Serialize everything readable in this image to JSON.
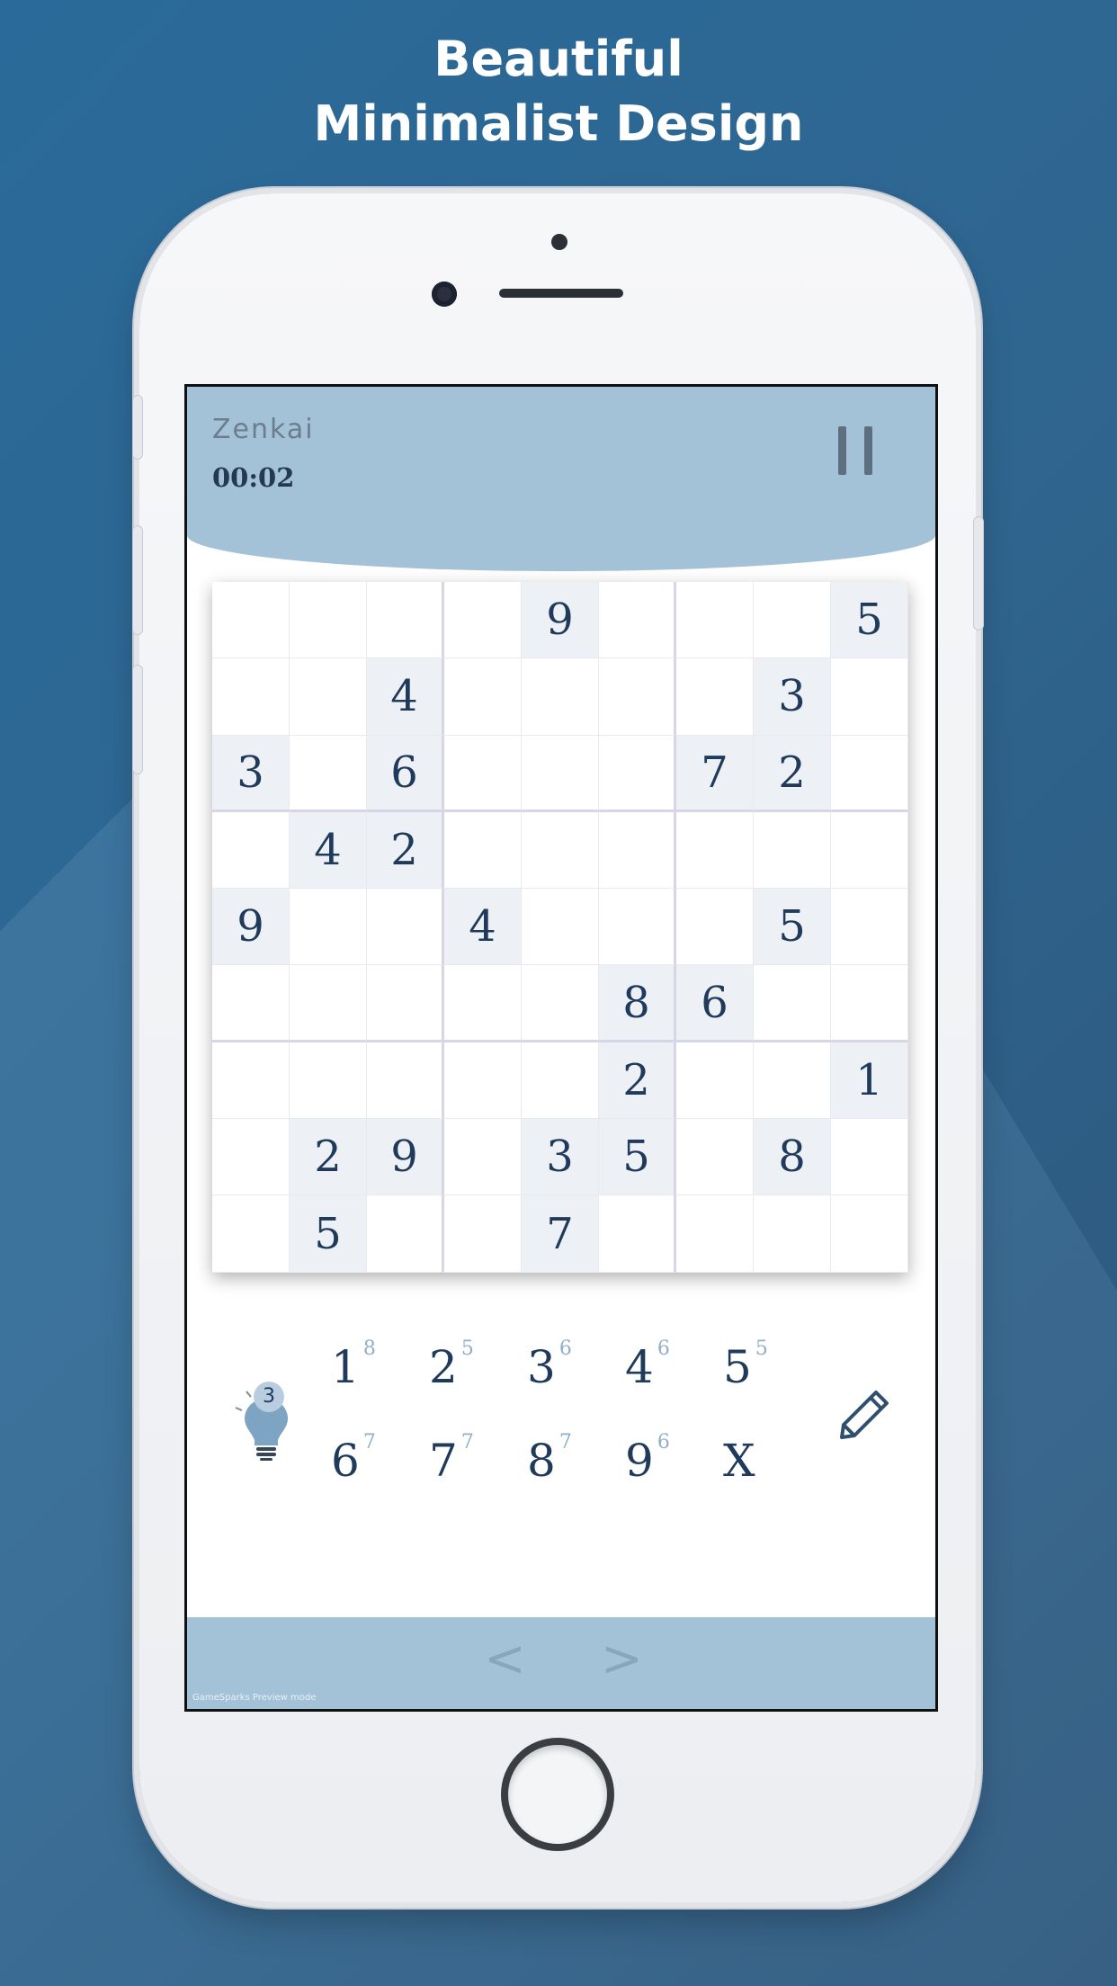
{
  "headline": {
    "line1": "Beautiful",
    "line2": "Minimalist Design"
  },
  "app": {
    "title": "Zenkai",
    "timer": "00:02",
    "pause_icon": "pause-icon"
  },
  "board": {
    "rows": [
      [
        "",
        "",
        "",
        "",
        "9",
        "",
        "",
        "",
        "5"
      ],
      [
        "",
        "",
        "4",
        "",
        "",
        "",
        "",
        "3",
        ""
      ],
      [
        "3",
        "",
        "6",
        "",
        "",
        "",
        "7",
        "2",
        ""
      ],
      [
        "",
        "4",
        "2",
        "",
        "",
        "",
        "",
        "",
        ""
      ],
      [
        "9",
        "",
        "",
        "4",
        "",
        "",
        "",
        "5",
        ""
      ],
      [
        "",
        "",
        "",
        "",
        "",
        "8",
        "6",
        "",
        ""
      ],
      [
        "",
        "",
        "",
        "",
        "",
        "2",
        "",
        "",
        "1"
      ],
      [
        "",
        "2",
        "9",
        "",
        "3",
        "5",
        "",
        "8",
        ""
      ],
      [
        "",
        "5",
        "",
        "",
        "7",
        "",
        "",
        "",
        ""
      ]
    ]
  },
  "numpad": {
    "keys": [
      {
        "label": "1",
        "count": "8"
      },
      {
        "label": "2",
        "count": "5"
      },
      {
        "label": "3",
        "count": "6"
      },
      {
        "label": "4",
        "count": "6"
      },
      {
        "label": "5",
        "count": "5"
      },
      {
        "label": "6",
        "count": "7"
      },
      {
        "label": "7",
        "count": "7"
      },
      {
        "label": "8",
        "count": "7"
      },
      {
        "label": "9",
        "count": "6"
      },
      {
        "label": "X",
        "count": ""
      }
    ]
  },
  "hint": {
    "icon": "lightbulb-icon",
    "count": "3"
  },
  "pencil": {
    "icon": "pencil-icon"
  },
  "footer": {
    "prev": "<",
    "next": ">",
    "preview_text": "GameSparks Preview mode"
  },
  "colors": {
    "header": "#a4c2d7",
    "digit": "#1f3a5a",
    "given_bg": "#edf1f6"
  }
}
